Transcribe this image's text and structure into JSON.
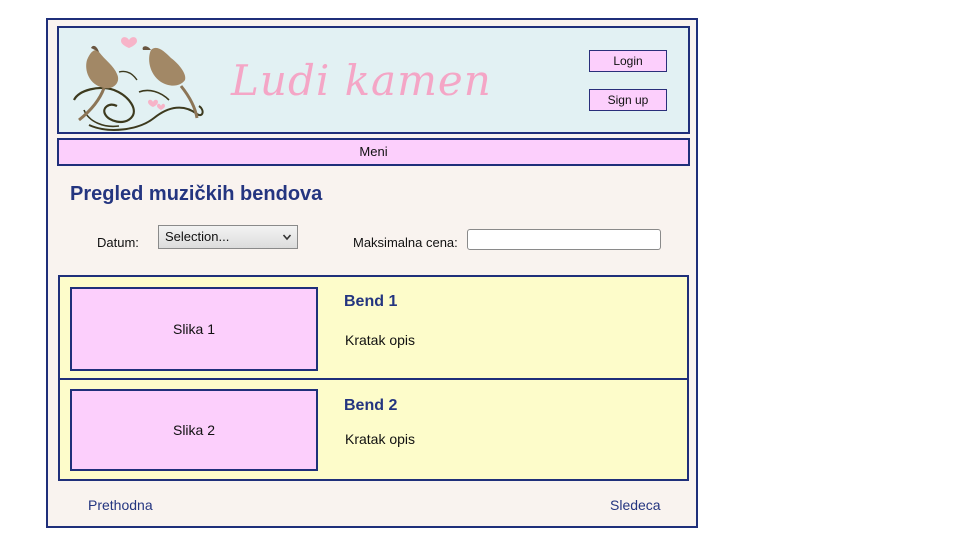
{
  "header": {
    "site_title": "Ludi kamen",
    "login_label": "Login",
    "signup_label": "Sign up"
  },
  "menu": {
    "label": "Meni"
  },
  "main": {
    "title": "Pregled muzičkih bendova",
    "filters": {
      "datum_label": "Datum:",
      "datum_value": "Selection...",
      "cena_label": "Maksimalna cena:",
      "cena_value": ""
    },
    "bands": [
      {
        "image_label": "Slika 1",
        "name": "Bend 1",
        "description": "Kratak opis"
      },
      {
        "image_label": "Slika 2",
        "name": "Bend 2",
        "description": "Kratak opis"
      }
    ]
  },
  "pager": {
    "prev_label": "Prethodna",
    "next_label": "Sledeca"
  },
  "colors": {
    "border": "#1f2f7a",
    "header_bg": "#e2f1f3",
    "pink": "#fccffc",
    "list_bg": "#fdfcca",
    "title_pink": "#f4a6c6",
    "heading_blue": "#243580"
  },
  "icons": {
    "logo": "birds-logo-icon",
    "dropdown": "chevron-down-icon"
  }
}
